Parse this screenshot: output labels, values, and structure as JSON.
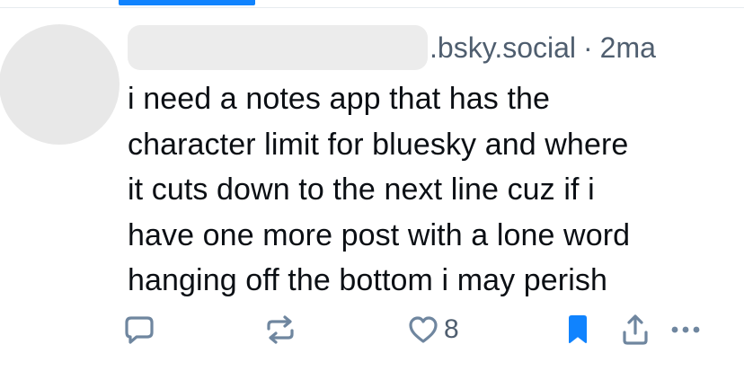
{
  "post": {
    "handle_suffix": ".bsky.social",
    "separator": "·",
    "timestamp": "2ma",
    "text": "i need a notes app that has the\ncharacter limit for bluesky and where\nit cuts down to the next line cuz if i\nhave one more post with a lone word\nhanging off the bottom i may perish"
  },
  "actions": {
    "like_count": "8",
    "icons": [
      "reply-icon",
      "repost-icon",
      "heart-icon",
      "bookmark-icon",
      "share-icon",
      "more-icon"
    ]
  },
  "colors": {
    "accent": "#1083fe",
    "muted_text": "#4f5e6f",
    "icon": "#6f869f",
    "text": "#0b0f14",
    "redaction": "#ececec"
  }
}
